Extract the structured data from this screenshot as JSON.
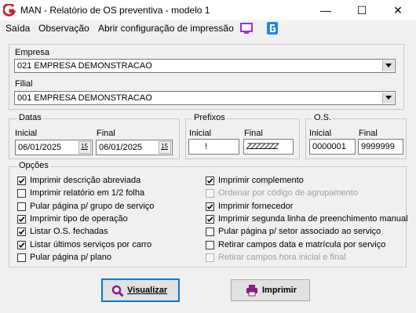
{
  "window": {
    "title": "MAN - Relatório de OS preventiva - modelo 1",
    "minimize": "—",
    "maximize": "☐",
    "close": "✕"
  },
  "menu": {
    "items": [
      "Saída",
      "Observação",
      "Abrir configuração de impressão"
    ]
  },
  "empresa": {
    "label": "Empresa",
    "value": "021 EMPRESA DEMONSTRACAO"
  },
  "filial": {
    "label": "Filial",
    "value": "001 EMPRESA DEMONSTRACAO"
  },
  "datas": {
    "title": "Datas",
    "inicial_label": "Inicial",
    "inicial_value": "06/01/2025",
    "final_label": "Final",
    "final_value": "06/01/2025",
    "cal_icon": "15"
  },
  "prefixos": {
    "title": "Prefixos",
    "inicial_label": "Inicial",
    "inicial_value": "!",
    "final_label": "Final",
    "final_value": "ZZZZZZZ"
  },
  "os": {
    "title": "O.S.",
    "inicial_label": "Inicial",
    "inicial_value": "0000001",
    "final_label": "Final",
    "final_value": "9999999"
  },
  "opcoes": {
    "title": "Opções",
    "left": [
      {
        "label": "Imprimir descrição abreviada",
        "checked": true,
        "enabled": true
      },
      {
        "label": "Imprimir relatório em 1/2 folha",
        "checked": false,
        "enabled": true
      },
      {
        "label": "Pular página p/ grupo de serviço",
        "checked": false,
        "enabled": true
      },
      {
        "label": "Imprimir tipo de operação",
        "checked": true,
        "enabled": true
      },
      {
        "label": "Listar O.S. fechadas",
        "checked": true,
        "enabled": true
      },
      {
        "label": "Listar últimos serviços por carro",
        "checked": true,
        "enabled": true
      },
      {
        "label": "Pular página p/ plano",
        "checked": false,
        "enabled": true
      }
    ],
    "right": [
      {
        "label": "Imprimir complemento",
        "checked": true,
        "enabled": true
      },
      {
        "label": "Ordenar por código de agrupamento",
        "checked": false,
        "enabled": false
      },
      {
        "label": "Imprimir fornecedor",
        "checked": true,
        "enabled": true
      },
      {
        "label": "Imprimir segunda linha de preenchimento manual",
        "checked": true,
        "enabled": true
      },
      {
        "label": "Pular página p/ setor associado ao serviço",
        "checked": false,
        "enabled": true
      },
      {
        "label": "Retirar campos data e matrícula por serviço",
        "checked": false,
        "enabled": true
      },
      {
        "label": "Retirar campos hora inicial e final",
        "checked": false,
        "enabled": false
      }
    ]
  },
  "buttons": {
    "visualizar": "Visualizar",
    "imprimir": "Imprimir"
  },
  "colors": {
    "brand_red": "#c0272d",
    "accent_blue": "#0078d7",
    "monitor_purple": "#9b2fc9",
    "printer_purple": "#8a1c8a"
  },
  "icons": {
    "app": "app-logo-icon",
    "monitor": "monitor-icon",
    "config": "config-icon",
    "magnifier": "magnifier-icon",
    "printer": "printer-icon"
  }
}
